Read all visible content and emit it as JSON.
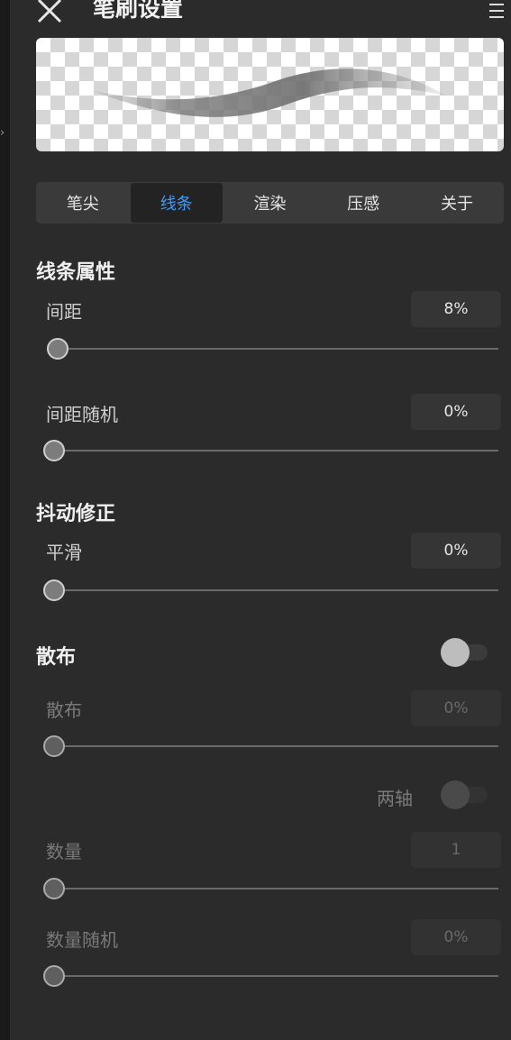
{
  "header": {
    "title": "笔刷设置"
  },
  "tabs": [
    {
      "label": "笔尖",
      "active": false
    },
    {
      "label": "线条",
      "active": true
    },
    {
      "label": "渲染",
      "active": false
    },
    {
      "label": "压感",
      "active": false
    },
    {
      "label": "关于",
      "active": false
    }
  ],
  "line_props": {
    "title": "线条属性",
    "spacing": {
      "label": "间距",
      "value": "8%",
      "level": 0.08
    },
    "spacing_random": {
      "label": "间距随机",
      "value": "0%",
      "level": 0
    }
  },
  "jitter": {
    "title": "抖动修正",
    "smooth": {
      "label": "平滑",
      "value": "0%",
      "level": 0
    }
  },
  "scatter": {
    "title": "散布",
    "enabled": false,
    "scatter": {
      "label": "散布",
      "value": "0%",
      "level": 0
    },
    "two_axis": {
      "label": "两轴",
      "enabled": false
    },
    "count": {
      "label": "数量",
      "value": "1",
      "level": 0
    },
    "count_random": {
      "label": "数量随机",
      "value": "0%",
      "level": 0
    }
  },
  "colors": {
    "accent": "#3d9bff",
    "panel": "#2b2b2b"
  },
  "icons": [
    "close-icon",
    "menu-icon",
    "collapse-arrow-icon"
  ]
}
